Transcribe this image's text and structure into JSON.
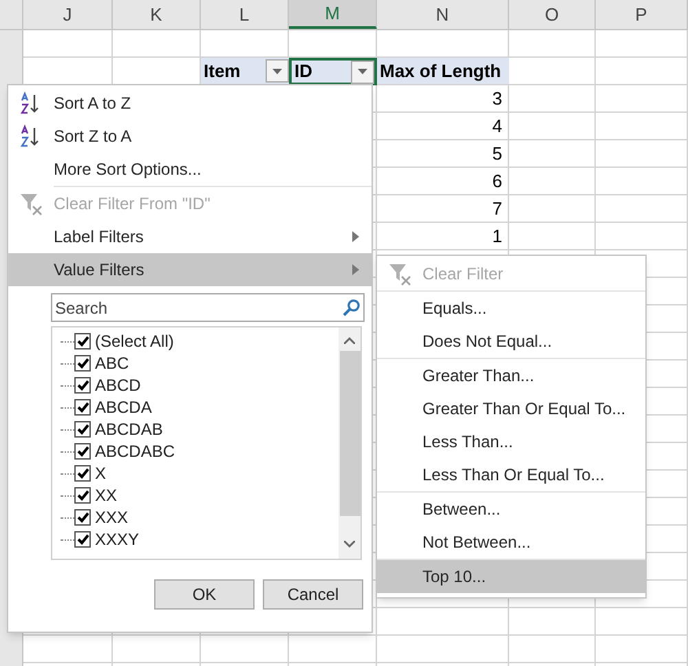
{
  "sheet": {
    "columns": [
      {
        "label": "J",
        "selected": false
      },
      {
        "label": "K",
        "selected": false
      },
      {
        "label": "L",
        "selected": false
      },
      {
        "label": "M",
        "selected": true
      },
      {
        "label": "N",
        "selected": false
      },
      {
        "label": "O",
        "selected": false
      },
      {
        "label": "P",
        "selected": false
      }
    ],
    "pivot_headers": [
      {
        "label": "Item",
        "dropdown": true,
        "selected": false
      },
      {
        "label": "ID",
        "dropdown": true,
        "selected": true
      },
      {
        "label": "Max of Length",
        "dropdown": false,
        "selected": false
      }
    ],
    "values": [
      "3",
      "4",
      "5",
      "6",
      "7",
      "1"
    ]
  },
  "filter_menu": {
    "groups": [
      [
        {
          "kind": "sort_asc",
          "label": "Sort A to Z",
          "disabled": false,
          "selected": false
        },
        {
          "kind": "sort_desc",
          "label": "Sort Z to A",
          "disabled": false,
          "selected": false
        },
        {
          "kind": "plain",
          "label": "More Sort Options...",
          "disabled": false,
          "selected": false
        }
      ],
      [
        {
          "kind": "clear",
          "label": "Clear Filter From \"ID\"",
          "disabled": true,
          "selected": false
        },
        {
          "kind": "submenu",
          "label": "Label Filters",
          "disabled": false,
          "selected": false
        },
        {
          "kind": "submenu",
          "label": "Value Filters",
          "disabled": false,
          "selected": true
        }
      ]
    ],
    "search": {
      "placeholder": "Search"
    },
    "items": [
      {
        "label": "(Select All)",
        "checked": true
      },
      {
        "label": "ABC",
        "checked": true
      },
      {
        "label": "ABCD",
        "checked": true
      },
      {
        "label": "ABCDA",
        "checked": true
      },
      {
        "label": "ABCDAB",
        "checked": true
      },
      {
        "label": "ABCDABC",
        "checked": true
      },
      {
        "label": "X",
        "checked": true
      },
      {
        "label": "XX",
        "checked": true
      },
      {
        "label": "XXX",
        "checked": true
      },
      {
        "label": "XXXY",
        "checked": true
      }
    ],
    "buttons": [
      "OK",
      "Cancel"
    ]
  },
  "value_filters_menu": {
    "groups": [
      [
        {
          "kind": "clear",
          "label": "Clear Filter",
          "disabled": true,
          "selected": false
        }
      ],
      [
        {
          "kind": "plain",
          "label": "Equals...",
          "disabled": false,
          "selected": false
        },
        {
          "kind": "plain",
          "label": "Does Not Equal...",
          "disabled": false,
          "selected": false
        }
      ],
      [
        {
          "kind": "plain",
          "label": "Greater Than...",
          "disabled": false,
          "selected": false
        },
        {
          "kind": "plain",
          "label": "Greater Than Or Equal To...",
          "disabled": false,
          "selected": false
        },
        {
          "kind": "plain",
          "label": "Less Than...",
          "disabled": false,
          "selected": false
        },
        {
          "kind": "plain",
          "label": "Less Than Or Equal To...",
          "disabled": false,
          "selected": false
        }
      ],
      [
        {
          "kind": "plain",
          "label": "Between...",
          "disabled": false,
          "selected": false
        },
        {
          "kind": "plain",
          "label": "Not Between...",
          "disabled": false,
          "selected": false
        }
      ],
      [
        {
          "kind": "plain",
          "label": "Top 10...",
          "disabled": false,
          "selected": true
        }
      ]
    ]
  }
}
